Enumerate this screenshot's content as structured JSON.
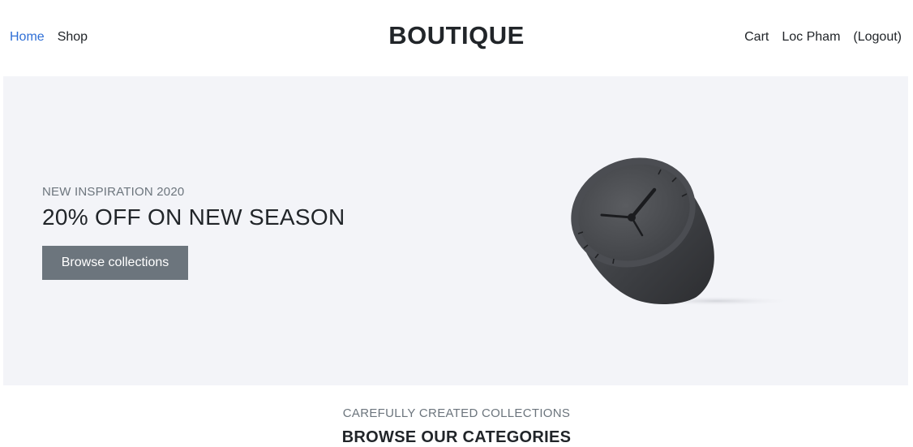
{
  "nav": {
    "left": [
      {
        "label": "Home",
        "active": true
      },
      {
        "label": "Shop",
        "active": false
      }
    ],
    "brand": "BOUTIQUE",
    "right": {
      "cart": "Cart",
      "user": "Loc Pham",
      "logout": "(Logout)"
    }
  },
  "hero": {
    "eyebrow": "NEW INSPIRATION 2020",
    "headline": "20% OFF ON NEW SEASON",
    "cta_label": "Browse collections",
    "image_icon": "table-clock-image"
  },
  "categories": {
    "eyebrow": "CAREFULLY CREATED COLLECTIONS",
    "title": "BROWSE OUR CATEGORIES"
  },
  "colors": {
    "link_active": "#2f6fd6",
    "hero_bg": "#f3f4f8",
    "button_bg": "#6c757d",
    "muted_text": "#6c757d"
  }
}
